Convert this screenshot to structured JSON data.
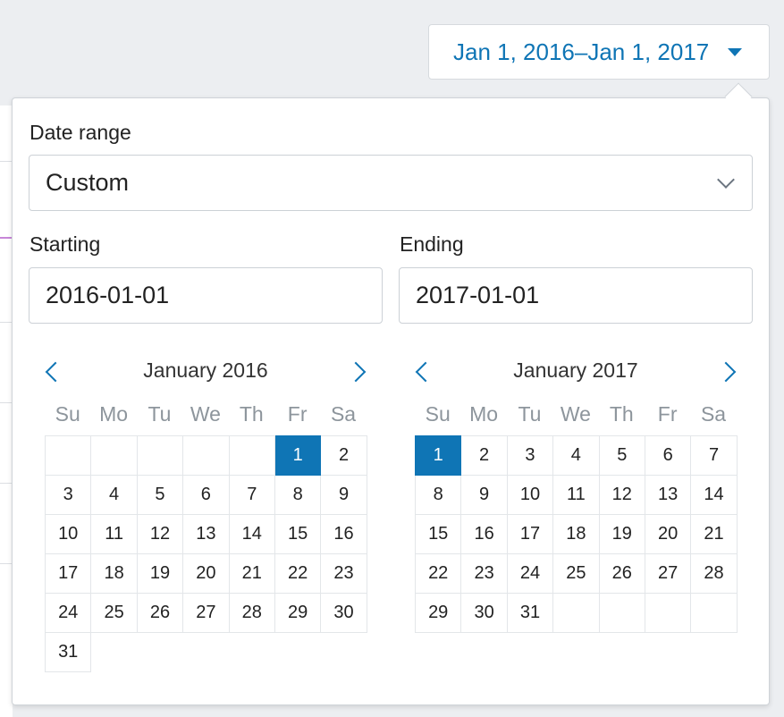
{
  "trigger": {
    "label": "Jan 1, 2016–Jan 1, 2017"
  },
  "popover": {
    "range_label": "Date range",
    "range_value": "Custom",
    "starting_label": "Starting",
    "ending_label": "Ending",
    "starting_value": "2016-01-01",
    "ending_value": "2017-01-01"
  },
  "weekdays": [
    "Su",
    "Mo",
    "Tu",
    "We",
    "Th",
    "Fr",
    "Sa"
  ],
  "calendars": [
    {
      "title": "January 2016",
      "first_weekday": 5,
      "days": 31,
      "total_rows": 6,
      "selected_day": 1
    },
    {
      "title": "January 2017",
      "first_weekday": 0,
      "days": 31,
      "total_rows": 5,
      "selected_day": 1
    }
  ],
  "colors": {
    "accent": "#0f75b5",
    "muted": "#8d959c"
  }
}
